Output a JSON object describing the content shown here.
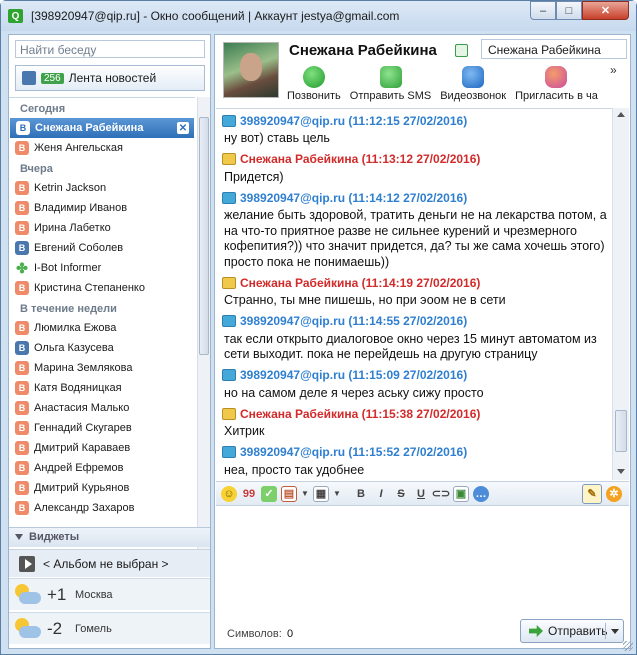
{
  "window": {
    "title": "[398920947@qip.ru] - Окно сообщений | Аккаунт jestya@gmail.com",
    "buttons": {
      "minimize": "–",
      "maximize": "□",
      "close": "✕"
    }
  },
  "sidebar": {
    "search_placeholder": "Найти беседу",
    "news_feed": {
      "badge": "256",
      "label": "Лента новостей"
    },
    "groups": [
      {
        "name": "Сегодня",
        "items": [
          {
            "name": "Снежана Рабейкина",
            "icon": "vk-blue",
            "selected": true
          },
          {
            "name": "Женя Ангельская",
            "icon": "vk-orange"
          }
        ]
      },
      {
        "name": "Вчера",
        "items": [
          {
            "name": "Ketrin Jackson",
            "icon": "vk-orange"
          },
          {
            "name": "Владимир Иванов",
            "icon": "vk-orange"
          },
          {
            "name": "Ирина Лабетко",
            "icon": "vk-orange"
          },
          {
            "name": "Евгений Соболев",
            "icon": "vk-blue"
          },
          {
            "name": "I-Bot Informer",
            "icon": "clover"
          },
          {
            "name": "Кристина Степаненко",
            "icon": "vk-orange"
          }
        ]
      },
      {
        "name": "В течение недели",
        "items": [
          {
            "name": "Люмилка Ежова",
            "icon": "vk-orange"
          },
          {
            "name": "Ольга Казусева",
            "icon": "vk-blue"
          },
          {
            "name": "Марина Землякова",
            "icon": "vk-orange"
          },
          {
            "name": "Катя Водяницкая",
            "icon": "vk-orange"
          },
          {
            "name": "Анастасия Малько",
            "icon": "vk-orange"
          },
          {
            "name": "Геннадий Скугарев",
            "icon": "vk-orange"
          },
          {
            "name": "Дмитрий Караваев",
            "icon": "vk-orange"
          },
          {
            "name": "Андрей Ефремов",
            "icon": "vk-orange"
          },
          {
            "name": "Дмитрий Курьянов",
            "icon": "vk-orange"
          },
          {
            "name": "Александр Захаров",
            "icon": "vk-orange"
          }
        ]
      }
    ],
    "widgets": {
      "header": "Виджеты",
      "album": "< Альбом не выбран >",
      "weather": [
        {
          "temp": "+1",
          "city": "Москва"
        },
        {
          "temp": "-2",
          "city": "Гомель"
        }
      ]
    }
  },
  "chat": {
    "contact_name": "Снежана Рабейкина",
    "nick_field": "Снежана Рабейкина",
    "actions": [
      {
        "label": "Позвонить",
        "icon": "phone-icon"
      },
      {
        "label": "Отправить SMS",
        "icon": "sms-icon"
      },
      {
        "label": "Видеозвонок",
        "icon": "video-call-icon"
      },
      {
        "label": "Пригласить в ча",
        "icon": "invite-icon"
      }
    ],
    "more": "»",
    "messages": [
      {
        "from": "me",
        "header": "398920947@qip.ru (11:12:15 27/02/2016)",
        "text": "ну вот) ставь цель"
      },
      {
        "from": "her",
        "header": "Снежана Рабейкина (11:13:12 27/02/2016)",
        "text": "Придется)"
      },
      {
        "from": "me",
        "header": "398920947@qip.ru (11:14:12 27/02/2016)",
        "text": "желание быть здоровой, тратить деньги не на лекарства потом, а на что-то приятное разве не сильнее курений и чрезмерного кофепития?)) что значит придется, да? ты же сама хочешь этого) просто пока не понимаешь))"
      },
      {
        "from": "her",
        "header": "Снежана Рабейкина (11:14:19 27/02/2016)",
        "text": "Странно, ты мне пишешь, но при эоом не в сети"
      },
      {
        "from": "me",
        "header": "398920947@qip.ru (11:14:55 27/02/2016)",
        "text": "так если открыто диалоговое окно через 15 минут автоматом из сети выходит. пока не перейдешь на другую страницу"
      },
      {
        "from": "me",
        "header": "398920947@qip.ru (11:15:09 27/02/2016)",
        "text": "но на самом деле я через аську сижу просто"
      },
      {
        "from": "her",
        "header": "Снежана Рабейкина (11:15:38 27/02/2016)",
        "text": "Хитрик"
      },
      {
        "from": "me",
        "header": "398920947@qip.ru (11:15:52 27/02/2016)",
        "text": "неа, просто так удобнее"
      }
    ],
    "counter_label": "Символов:",
    "counter_value": "0",
    "send_label": "Отправить"
  }
}
